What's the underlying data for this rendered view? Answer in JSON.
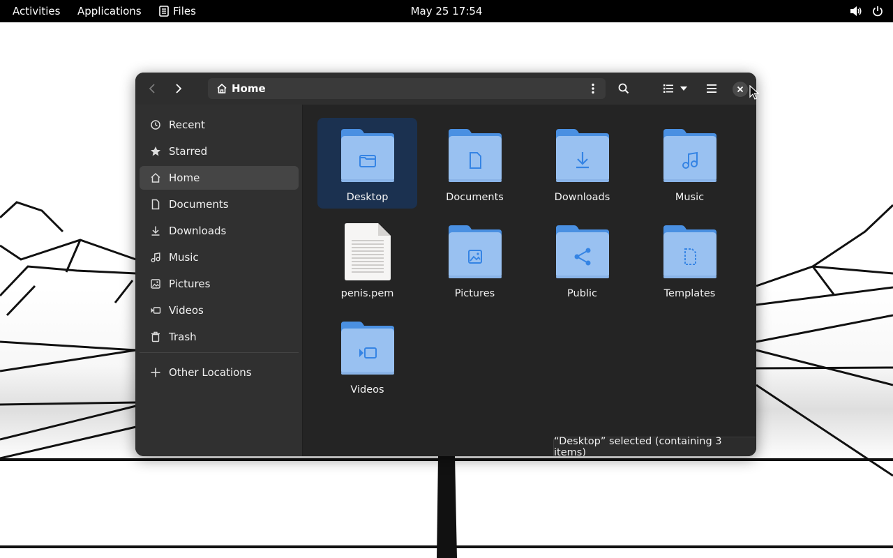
{
  "topbar": {
    "activities": "Activities",
    "applications": "Applications",
    "app_name": "Files",
    "clock": "May 25  17:54"
  },
  "headerbar": {
    "path_label": "Home"
  },
  "sidebar": {
    "items": [
      {
        "label": "Recent",
        "icon": "clock-icon"
      },
      {
        "label": "Starred",
        "icon": "star-icon"
      },
      {
        "label": "Home",
        "icon": "home-icon"
      },
      {
        "label": "Documents",
        "icon": "document-icon"
      },
      {
        "label": "Downloads",
        "icon": "download-icon"
      },
      {
        "label": "Music",
        "icon": "music-icon"
      },
      {
        "label": "Pictures",
        "icon": "picture-icon"
      },
      {
        "label": "Videos",
        "icon": "video-icon"
      },
      {
        "label": "Trash",
        "icon": "trash-icon"
      }
    ],
    "other_locations": "Other Locations"
  },
  "files": [
    {
      "label": "Desktop",
      "kind": "folder",
      "emblem": "folder-icon",
      "selected": true
    },
    {
      "label": "Documents",
      "kind": "folder",
      "emblem": "document-icon"
    },
    {
      "label": "Downloads",
      "kind": "folder",
      "emblem": "download-icon"
    },
    {
      "label": "Music",
      "kind": "folder",
      "emblem": "music-icon"
    },
    {
      "label": "penis.pem",
      "kind": "file",
      "emblem": "text-file-icon"
    },
    {
      "label": "Pictures",
      "kind": "folder",
      "emblem": "picture-icon"
    },
    {
      "label": "Public",
      "kind": "folder",
      "emblem": "share-icon"
    },
    {
      "label": "Templates",
      "kind": "folder",
      "emblem": "template-icon"
    },
    {
      "label": "Videos",
      "kind": "folder",
      "emblem": "video-icon"
    }
  ],
  "status": "“Desktop” selected  (containing 3 items)",
  "colors": {
    "folder": "#4a90e2",
    "folder_front": "#99c1f1",
    "selection": "#1b3150",
    "window_bg": "#242424",
    "sidebar_bg": "#303030"
  }
}
